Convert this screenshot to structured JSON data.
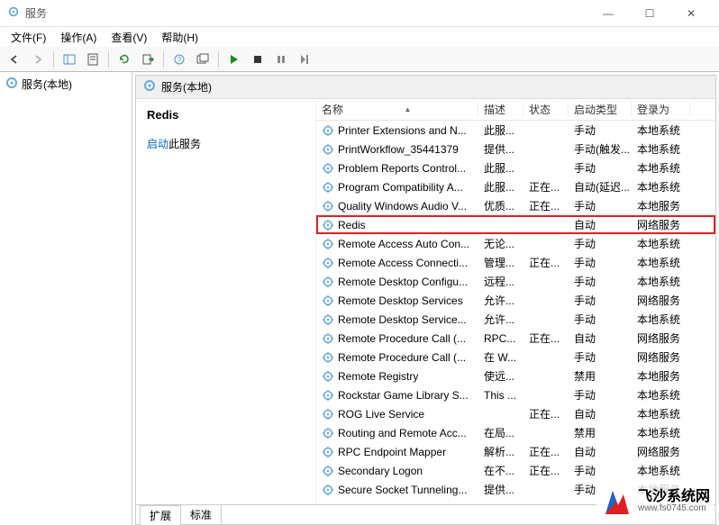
{
  "window": {
    "title": "服务",
    "min": "—",
    "max": "☐",
    "close": "✕"
  },
  "menu": {
    "file": "文件(F)",
    "action": "操作(A)",
    "view": "查看(V)",
    "help": "帮助(H)"
  },
  "sidebar": {
    "root": "服务(本地)"
  },
  "content": {
    "header": "服务(本地)",
    "selected": "Redis",
    "action_link": "启动",
    "action_suffix": "此服务"
  },
  "columns": {
    "name": "名称",
    "desc": "描述",
    "status": "状态",
    "start": "启动类型",
    "logon": "登录为"
  },
  "tabs": {
    "extended": "扩展",
    "standard": "标准"
  },
  "services": [
    {
      "name": "Printer Extensions and N...",
      "desc": "此服...",
      "status": "",
      "start": "手动",
      "logon": "本地系统"
    },
    {
      "name": "PrintWorkflow_35441379",
      "desc": "提供...",
      "status": "",
      "start": "手动(触发...",
      "logon": "本地系统"
    },
    {
      "name": "Problem Reports Control...",
      "desc": "此服...",
      "status": "",
      "start": "手动",
      "logon": "本地系统"
    },
    {
      "name": "Program Compatibility A...",
      "desc": "此服...",
      "status": "正在...",
      "start": "自动(延迟...",
      "logon": "本地系统"
    },
    {
      "name": "Quality Windows Audio V...",
      "desc": "优质...",
      "status": "正在...",
      "start": "手动",
      "logon": "本地服务"
    },
    {
      "name": "Redis",
      "desc": "",
      "status": "",
      "start": "自动",
      "logon": "网络服务",
      "hl": true
    },
    {
      "name": "Remote Access Auto Con...",
      "desc": "无论...",
      "status": "",
      "start": "手动",
      "logon": "本地系统"
    },
    {
      "name": "Remote Access Connecti...",
      "desc": "管理...",
      "status": "正在...",
      "start": "手动",
      "logon": "本地系统"
    },
    {
      "name": "Remote Desktop Configu...",
      "desc": "远程...",
      "status": "",
      "start": "手动",
      "logon": "本地系统"
    },
    {
      "name": "Remote Desktop Services",
      "desc": "允许...",
      "status": "",
      "start": "手动",
      "logon": "网络服务"
    },
    {
      "name": "Remote Desktop Service...",
      "desc": "允许...",
      "status": "",
      "start": "手动",
      "logon": "本地系统"
    },
    {
      "name": "Remote Procedure Call (...",
      "desc": "RPC...",
      "status": "正在...",
      "start": "自动",
      "logon": "网络服务"
    },
    {
      "name": "Remote Procedure Call (...",
      "desc": "在 W...",
      "status": "",
      "start": "手动",
      "logon": "网络服务"
    },
    {
      "name": "Remote Registry",
      "desc": "使远...",
      "status": "",
      "start": "禁用",
      "logon": "本地服务"
    },
    {
      "name": "Rockstar Game Library S...",
      "desc": "This ...",
      "status": "",
      "start": "手动",
      "logon": "本地系统"
    },
    {
      "name": "ROG Live Service",
      "desc": "",
      "status": "正在...",
      "start": "自动",
      "logon": "本地系统"
    },
    {
      "name": "Routing and Remote Acc...",
      "desc": "在局...",
      "status": "",
      "start": "禁用",
      "logon": "本地系统"
    },
    {
      "name": "RPC Endpoint Mapper",
      "desc": "解析...",
      "status": "正在...",
      "start": "自动",
      "logon": "网络服务"
    },
    {
      "name": "Secondary Logon",
      "desc": "在不...",
      "status": "正在...",
      "start": "手动",
      "logon": "本地系统"
    },
    {
      "name": "Secure Socket Tunneling...",
      "desc": "提供...",
      "status": "",
      "start": "手动",
      "logon": "本地服务"
    }
  ],
  "watermark": {
    "line1": "飞沙系统网",
    "line2": "www.fs0745.com"
  }
}
